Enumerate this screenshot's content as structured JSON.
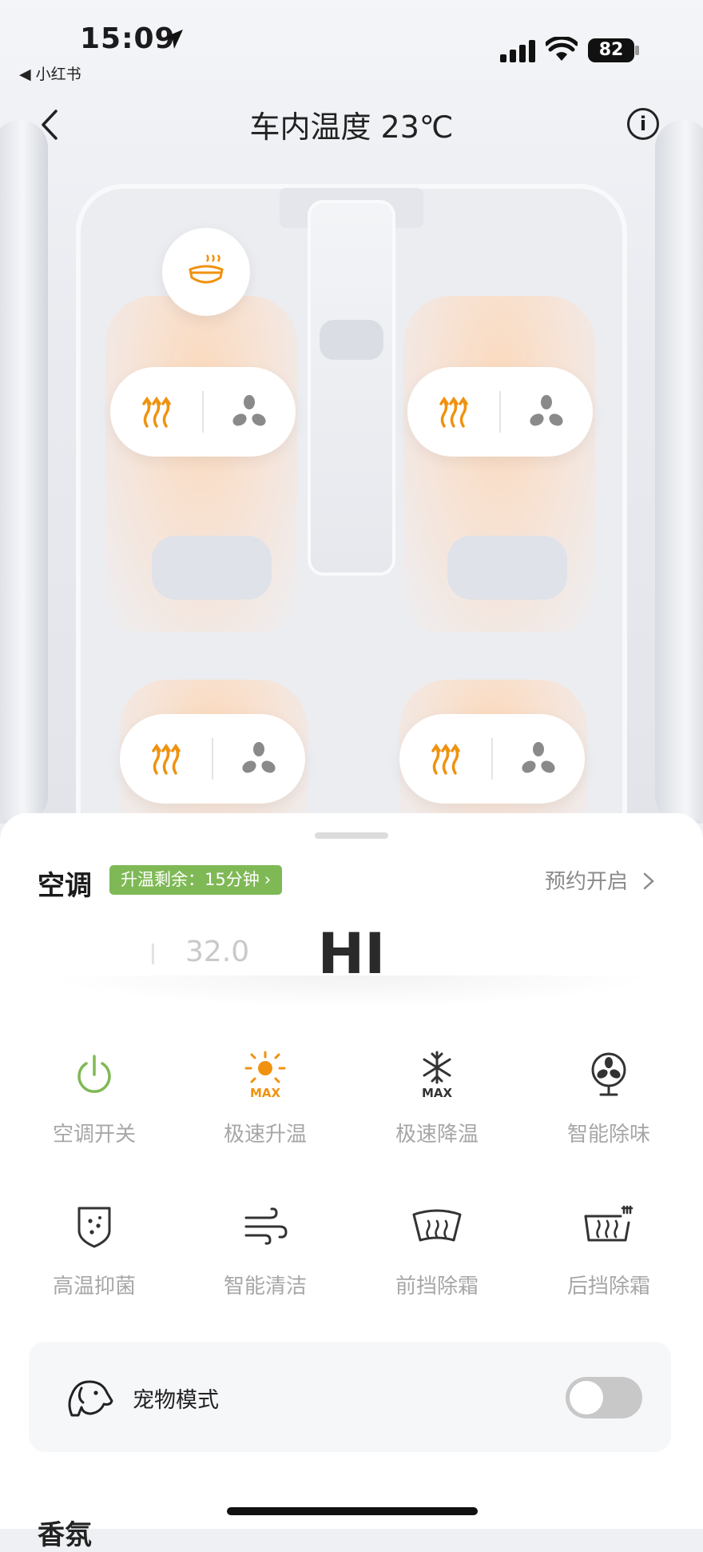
{
  "status_bar": {
    "time": "15:09",
    "back_app": "◀ 小红书",
    "battery": "82"
  },
  "nav": {
    "title": "车内温度 23℃"
  },
  "colors": {
    "heat_active": "#f0920f",
    "fan_inactive": "#8a8a8a",
    "power_green": "#7fb956",
    "badge_green": "#7fb956"
  },
  "seats": [
    {
      "position": "front-left",
      "heat": "heat-waves-icon",
      "vent": "fan-icon"
    },
    {
      "position": "front-right",
      "heat": "heat-waves-icon",
      "vent": "fan-icon"
    },
    {
      "position": "rear-left",
      "heat": "heat-waves-icon",
      "vent": "fan-icon"
    },
    {
      "position": "rear-right",
      "heat": "heat-waves-icon",
      "vent": "fan-icon"
    }
  ],
  "ac": {
    "title": "空调",
    "timer_badge": "升温剩余：15分钟",
    "schedule": "预约开启",
    "temp_prev": "32.0",
    "temp_current": "HI"
  },
  "functions": [
    {
      "label": "空调开关",
      "icon": "power-icon"
    },
    {
      "label": "极速升温",
      "icon": "sun-max-icon"
    },
    {
      "label": "极速降温",
      "icon": "snowflake-max-icon"
    },
    {
      "label": "智能除味",
      "icon": "fan-deodorize-icon"
    },
    {
      "label": "高温抑菌",
      "icon": "shield-sterilize-icon"
    },
    {
      "label": "智能清洁",
      "icon": "wind-clean-icon"
    },
    {
      "label": "前挡除霜",
      "icon": "front-defrost-icon"
    },
    {
      "label": "后挡除霜",
      "icon": "rear-defrost-icon"
    }
  ],
  "pet_mode": {
    "label": "宠物模式",
    "enabled": false
  },
  "next_section": "香氛"
}
